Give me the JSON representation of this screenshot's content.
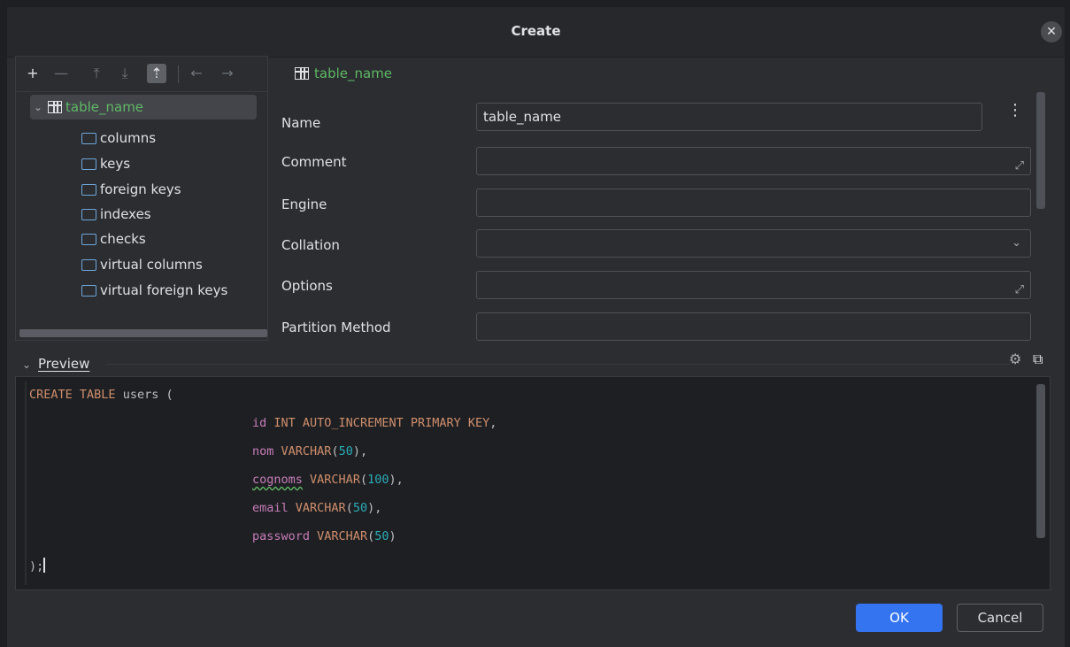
{
  "dialog": {
    "title": "Create",
    "close_icon": "close-icon"
  },
  "tree_toolbar": {
    "buttons": [
      "add-icon",
      "remove-icon",
      "move-up-icon",
      "move-down-icon",
      "move-top-icon",
      "back-arrow-icon",
      "forward-arrow-icon"
    ]
  },
  "tree": {
    "root_label": "table_name",
    "children": [
      "columns",
      "keys",
      "foreign keys",
      "indexes",
      "checks",
      "virtual columns",
      "virtual foreign keys"
    ]
  },
  "properties": {
    "header": "table_name",
    "fields": [
      {
        "label": "Name",
        "value": "table_name"
      },
      {
        "label": "Comment",
        "value": ""
      },
      {
        "label": "Engine",
        "value": ""
      },
      {
        "label": "Collation",
        "value": ""
      },
      {
        "label": "Options",
        "value": ""
      },
      {
        "label": "Partition Method",
        "value": ""
      }
    ]
  },
  "preview": {
    "title": "Preview",
    "lines": [
      "CREATE TABLE users (",
      "id INT AUTO_INCREMENT PRIMARY KEY,",
      "nom VARCHAR(50),",
      "cognoms VARCHAR(100),",
      "email VARCHAR(50),",
      "password VARCHAR(50)",
      ");"
    ]
  },
  "buttons": {
    "ok": "OK",
    "cancel": "Cancel"
  },
  "colors": {
    "accent": "#3574f0",
    "background": "#2b2d30",
    "editor_bg": "#1e1f22",
    "keyword": "#cf8e6d",
    "number": "#2aacb8",
    "green_label": "#5fb865"
  }
}
